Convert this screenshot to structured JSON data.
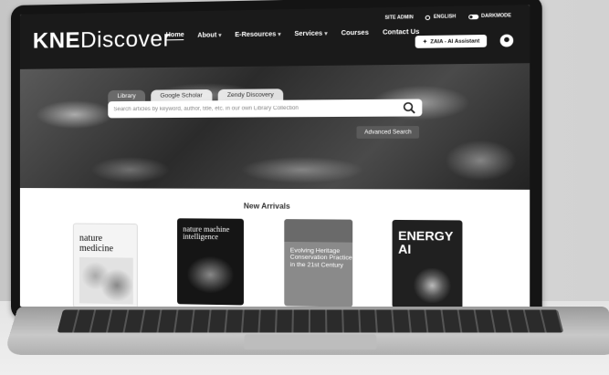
{
  "header": {
    "logo_bold": "KNE",
    "logo_light": "Discover",
    "nav": [
      {
        "label": "Home"
      },
      {
        "label": "About"
      },
      {
        "label": "E-Resources"
      },
      {
        "label": "Services"
      },
      {
        "label": "Courses"
      },
      {
        "label": "Contact Us"
      }
    ],
    "site_admin": "SITE ADMIN",
    "language": "ENGLISH",
    "darkmode": "DARKMODE",
    "assistant_label": "ZAIA - AI Assistant"
  },
  "hero": {
    "tabs": [
      {
        "label": "Library"
      },
      {
        "label": "Google Scholar"
      },
      {
        "label": "Zendy Discovery"
      }
    ],
    "search_placeholder": "Search articles by keyword, author, title, etc. in our own Library Collection",
    "advanced_search": "Advanced Search"
  },
  "new_arrivals": {
    "title": "New Arrivals",
    "books": [
      {
        "title": "nature medicine"
      },
      {
        "title": "nature machine intelligence"
      },
      {
        "title": "Evolving Heritage Conservation Practice in the 21st Century"
      },
      {
        "title": "ENERGY AI"
      }
    ]
  },
  "colors": {
    "nav_bg": "#1a1a1a",
    "advanced_button": "#5a5a5a"
  }
}
